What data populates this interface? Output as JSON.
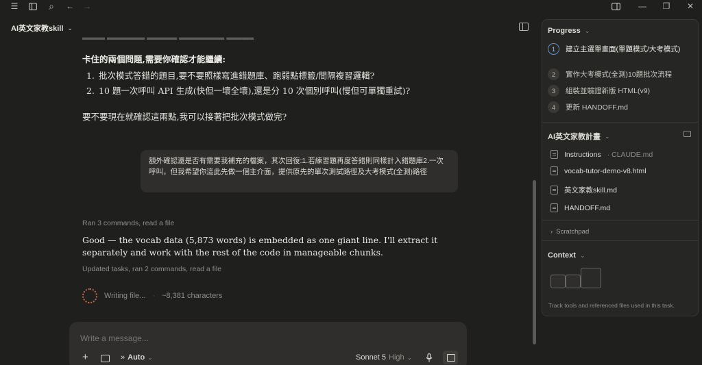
{
  "topbar": {
    "icons": [
      "menu-icon",
      "sidebar-icon",
      "search-icon",
      "back-icon",
      "forward-icon",
      "split-view-icon",
      "minimize-icon",
      "restore-icon",
      "close-icon"
    ],
    "glyphs": {
      "menu": "☰",
      "search": "⌕",
      "back": "←",
      "forward": "→",
      "minimize": "—",
      "restore": "❐",
      "close": "✕"
    }
  },
  "conversation": {
    "title": "AI英文家教skill",
    "chevron": "⌄"
  },
  "messages": {
    "question_head": "卡住的兩個問題,需要你確認才能繼續:",
    "questions": [
      {
        "num": "1.",
        "text": "批次模式答錯的題目,要不要照樣寫進錯題庫、跑弱點標籤/間隔複習邏輯?"
      },
      {
        "num": "2.",
        "text": "10 題一次呼叫 API 生成(快但一壞全壞),還是分 10 次個別呼叫(慢但可單獨重試)?"
      }
    ],
    "question_foot": "要不要現在就確認這兩點,我可以接著把批次模式做完?",
    "user_message": "額外確認還是否有需要我補充的檔案，其次回復:1.若練習題再度答錯則同樣計入錯題庫2.一次呼叫，但我希望你這此先做一個主介面，提供原先的單次測試路徑及大考模式(全測)路徑",
    "meta_1": "Ran 3 commands, read a file",
    "answer": "Good — the vocab data (5,873 words) is embedded as one giant line. I'll extract it separately and work with the rest of the code in manageable chunks.",
    "meta_2": "Updated tasks, ran 2 commands, read a file",
    "writing_label": "Writing file...",
    "writing_sep": "·",
    "writing_chars": "~8,381 characters"
  },
  "composer": {
    "placeholder": "Write a message...",
    "plus": "+",
    "auto_label": "Auto",
    "auto_icon": "»",
    "model": "Sonnet 5",
    "level": "High",
    "chevron": "⌄",
    "mic": "🎙"
  },
  "sidebar": {
    "progress": {
      "title": "Progress",
      "tasks": [
        {
          "num": "1",
          "text": "建立主選單畫面(單題模式/大考模式)"
        },
        {
          "num": "2",
          "text": "實作大考模式(全測)10題批次流程"
        },
        {
          "num": "3",
          "text": "組裝並驗證新版 HTML(v9)"
        },
        {
          "num": "4",
          "text": "更新 HANDOFF.md"
        }
      ]
    },
    "project": {
      "title": "AI英文家教計畫",
      "files": [
        {
          "name": "Instructions",
          "dim": "· CLAUDE.md"
        },
        {
          "name": "vocab-tutor-demo-v8.html",
          "dim": ""
        },
        {
          "name": "英文家教skill.md",
          "dim": ""
        },
        {
          "name": "HANDOFF.md",
          "dim": ""
        }
      ]
    },
    "scratchpad": {
      "label": "Scratchpad",
      "chevron": "›"
    },
    "context": {
      "title": "Context",
      "note": "Track tools and referenced files used in this task."
    }
  },
  "colors": {
    "background": "#1f1f1e",
    "panel": "#262624",
    "bubble": "#2f2e2c",
    "accent_active": "#5b8fd0",
    "spinner": "#c96a4a"
  }
}
